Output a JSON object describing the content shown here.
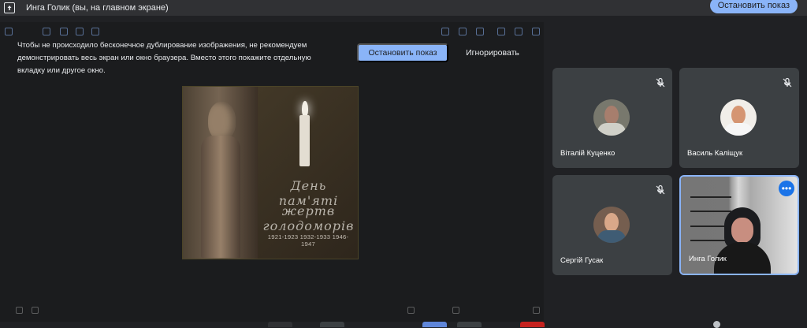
{
  "topbar": {
    "title": "Инга Голик (вы, на главном экране)",
    "stop_label": "Остановить показ",
    "share_icon": "present-to-all-icon"
  },
  "presentation": {
    "warning": "Чтобы не происходило бесконечное дублирование изображения, не рекомендуем демонстрировать весь экран или окно браузера. Вместо этого покажите отдельную вкладку или другое окно.",
    "stop_label": "Остановить показ",
    "ignore_label": "Игнорировать",
    "slide": {
      "title_line_1": "День пам'яті",
      "title_line_2": "жертв голодоморів",
      "years": "1921-1923  1932-1933  1946-1947"
    }
  },
  "participants": [
    {
      "name": "Віталій Куценко",
      "muted": true,
      "avatar": "participant-photo"
    },
    {
      "name": "Василь Каліщук",
      "muted": true,
      "avatar": "participant-photo"
    },
    {
      "name": "Сергій Гусак",
      "muted": true,
      "avatar": "participant-photo"
    },
    {
      "name": "Инга Голик",
      "muted": false,
      "camera": "participant-video"
    }
  ],
  "colors": {
    "background": "#202124",
    "tile": "#3c4043",
    "accent": "#8ab4f8",
    "active_border": "#8ab4f8"
  }
}
